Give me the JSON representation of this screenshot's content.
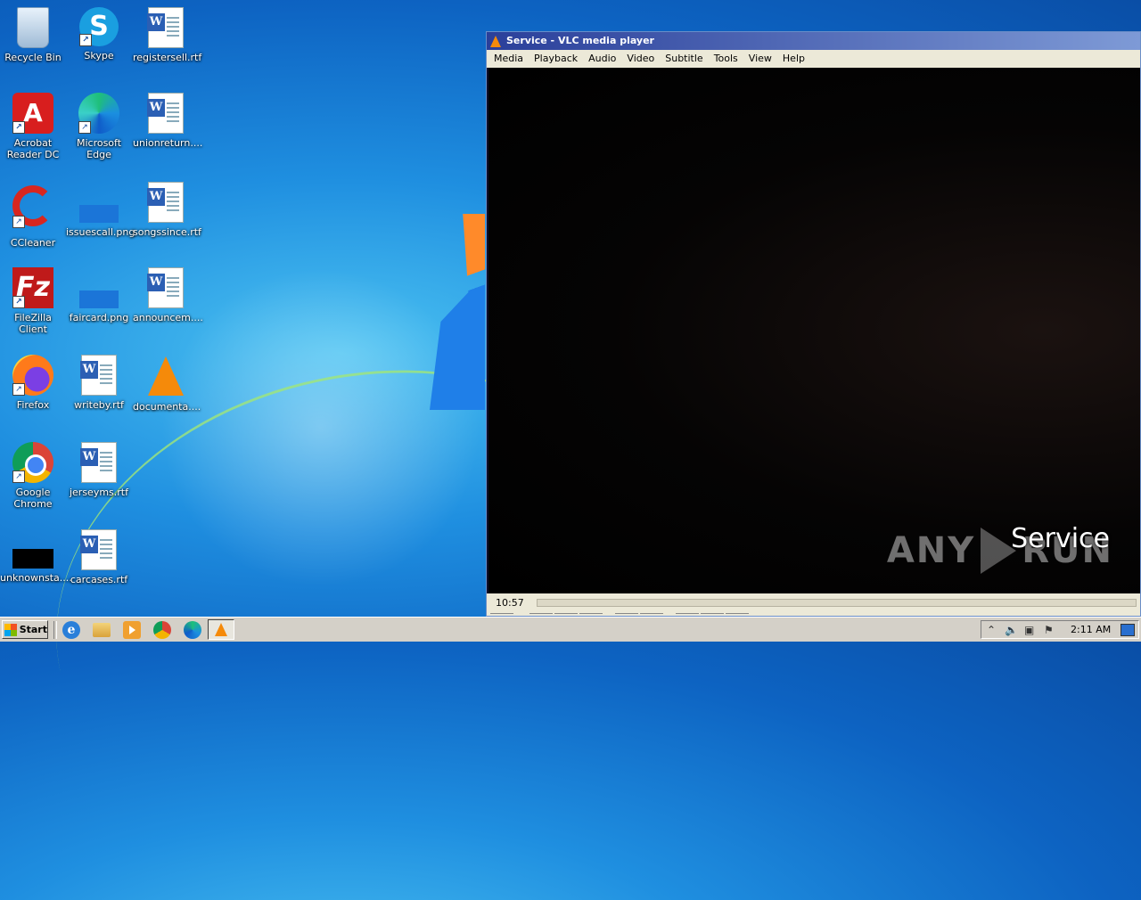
{
  "desktop": {
    "icons": [
      {
        "label": "Recycle Bin",
        "icon": "recycle-bin-icon"
      },
      {
        "label": "Skype",
        "icon": "skype-icon"
      },
      {
        "label": "registersell.rtf",
        "icon": "word-document-icon"
      },
      {
        "label": "Acrobat Reader DC",
        "icon": "acrobat-icon"
      },
      {
        "label": "Microsoft Edge",
        "icon": "edge-icon"
      },
      {
        "label": "unionreturn....",
        "icon": "word-document-icon"
      },
      {
        "label": "CCleaner",
        "icon": "ccleaner-icon"
      },
      {
        "label": "issuescall.png",
        "icon": "image-file-icon"
      },
      {
        "label": "songssince.rtf",
        "icon": "word-document-icon"
      },
      {
        "label": "FileZilla Client",
        "icon": "filezilla-icon"
      },
      {
        "label": "faircard.png",
        "icon": "image-file-icon"
      },
      {
        "label": "announcem....",
        "icon": "word-document-icon"
      },
      {
        "label": "Firefox",
        "icon": "firefox-icon"
      },
      {
        "label": "writeby.rtf",
        "icon": "word-document-icon"
      },
      {
        "label": "documenta....",
        "icon": "vlc-icon"
      },
      {
        "label": "Google Chrome",
        "icon": "chrome-icon"
      },
      {
        "label": "jerseyms.rtf",
        "icon": "word-document-icon"
      },
      {
        "label": "unknownsta....",
        "icon": "black-file-icon"
      },
      {
        "label": "carcases.rtf",
        "icon": "word-document-icon"
      }
    ]
  },
  "vlc": {
    "title": "Service - VLC media player",
    "menu": [
      "Media",
      "Playback",
      "Audio",
      "Video",
      "Subtitle",
      "Tools",
      "View",
      "Help"
    ],
    "subtitle": "Service",
    "time_elapsed": "10:57",
    "watermark_left": "ANY",
    "watermark_right": "RUN"
  },
  "taskbar": {
    "start_label": "Start",
    "clock": "2:11 AM"
  },
  "colors": {
    "titlebar_start": "#2a3f9a",
    "titlebar_end": "#7e9ad6",
    "taskbar": "#d4d0c8",
    "vlc_orange": "#f58a0a"
  }
}
